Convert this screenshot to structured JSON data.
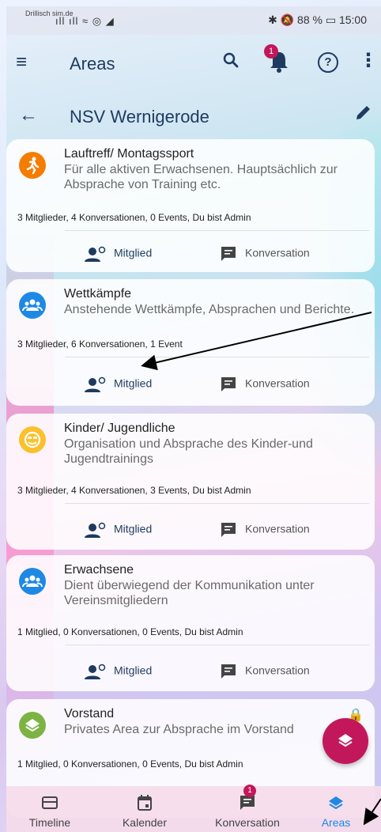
{
  "statusbar": {
    "carrier": "Drillisch sim.de",
    "signal": "ıll ıll ≈ ◎ ◢",
    "battery_time": "✱ 🔕 88 % ▭ 15:00"
  },
  "appbar": {
    "title": "Areas",
    "notification_count": "1"
  },
  "subbar": {
    "title": "NSV Wernigerode"
  },
  "cards": [
    {
      "name": "Lauftreff/ Montagssport",
      "desc": "Für alle aktiven Erwachsenen. Hauptsächlich zur Absprache von Training etc.",
      "stats": "3 Mitglieder, 4 Konversationen, 0 Events, Du bist Admin",
      "member_label": "Mitglied",
      "conv_label": "Konversation",
      "color": "#f57c00",
      "icon": "run-icon"
    },
    {
      "name": "Wettkämpfe",
      "desc": "Anstehende Wettkämpfe, Absprachen und Berichte.",
      "stats": "3 Mitglieder, 6 Konversationen, 1 Event",
      "member_label": "Mitglied",
      "conv_label": "Konversation",
      "color": "#1e88e5",
      "icon": "group-icon"
    },
    {
      "name": "Kinder/ Jugendliche",
      "desc": "Organisation und Absprache des Kinder-und Jugendtrainings",
      "stats": "3 Mitglieder, 4 Konversationen, 3 Events, Du bist Admin",
      "member_label": "Mitglied",
      "conv_label": "Konversation",
      "color": "#fbc02d",
      "icon": "smiley-icon"
    },
    {
      "name": "Erwachsene",
      "desc": "Dient überwiegend der Kommunikation unter Vereinsmitgliedern",
      "stats": "1 Mitglied, 0 Konversationen, 0 Events, Du bist Admin",
      "member_label": "Mitglied",
      "conv_label": "Konversation",
      "color": "#1e88e5",
      "icon": "group-icon"
    },
    {
      "name": "Vorstand",
      "desc": "Privates Area zur Absprache im Vorstand",
      "stats": "1 Mitglied, 0 Konversationen, 0 Events, Du bist Admin",
      "color": "#7cb342",
      "icon": "layers-icon"
    }
  ],
  "bottomnav": {
    "items": [
      {
        "label": "Timeline",
        "icon": "timeline-icon"
      },
      {
        "label": "Kalender",
        "icon": "calendar-icon"
      },
      {
        "label": "Konversation",
        "icon": "chat-icon",
        "badge": "1"
      },
      {
        "label": "Areas",
        "icon": "layers-icon",
        "active": true
      }
    ]
  },
  "colors": {
    "primary": "#1e3a5f",
    "accent": "#c2185b",
    "active": "#1e88e5"
  }
}
